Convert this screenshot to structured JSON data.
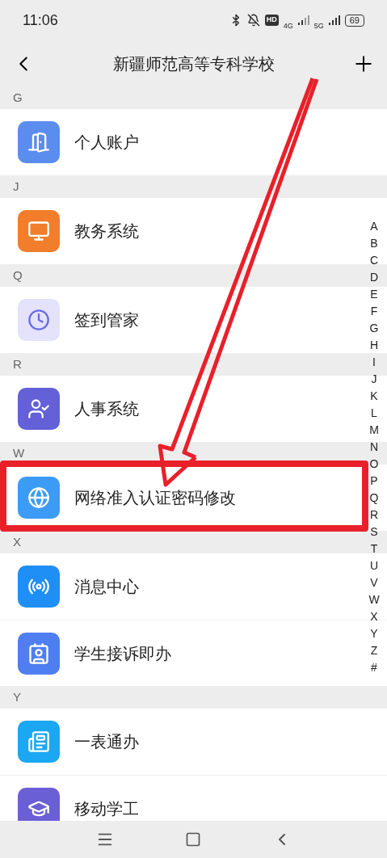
{
  "status_bar": {
    "time": "11:06",
    "hd": "HD",
    "net_1": "4G",
    "net_2": "5G",
    "battery": "69"
  },
  "header": {
    "title": "新疆师范高等专科学校"
  },
  "sections": [
    {
      "letter": "G",
      "items": [
        {
          "name": "个人账户"
        }
      ]
    },
    {
      "letter": "J",
      "items": [
        {
          "name": "教务系统"
        }
      ]
    },
    {
      "letter": "Q",
      "items": [
        {
          "name": "签到管家"
        }
      ]
    },
    {
      "letter": "R",
      "items": [
        {
          "name": "人事系统"
        }
      ]
    },
    {
      "letter": "W",
      "items": [
        {
          "name": "网络准入认证密码修改"
        }
      ]
    },
    {
      "letter": "X",
      "items": [
        {
          "name": "消息中心"
        },
        {
          "name": "学生接诉即办"
        }
      ]
    },
    {
      "letter": "Y",
      "items": [
        {
          "name": "一表通办"
        },
        {
          "name": "移动学工"
        }
      ]
    }
  ],
  "index_bar": [
    "A",
    "B",
    "C",
    "D",
    "E",
    "F",
    "G",
    "H",
    "I",
    "J",
    "K",
    "L",
    "M",
    "N",
    "O",
    "P",
    "Q",
    "R",
    "S",
    "T",
    "U",
    "V",
    "W",
    "X",
    "Y",
    "Z",
    "#"
  ]
}
